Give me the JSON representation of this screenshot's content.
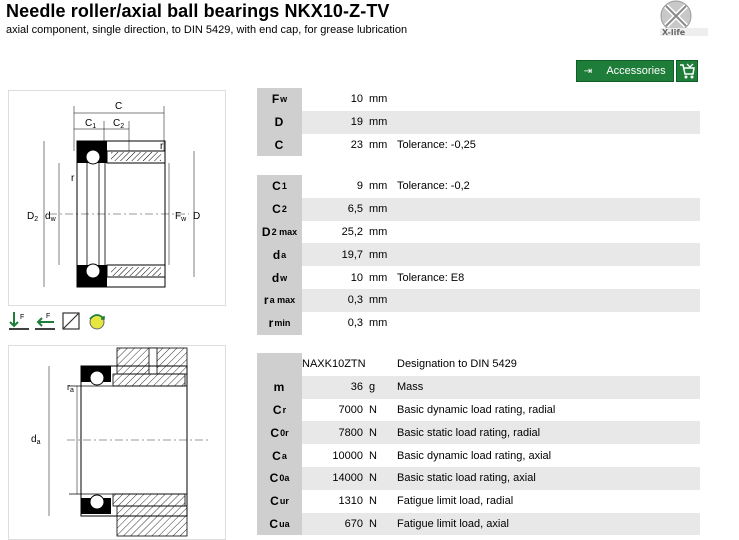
{
  "header": {
    "title": "Needle roller/axial ball bearings NKX10-Z-TV",
    "subtitle": "axial component, single direction, to DIN 5429, with end cap, for grease lubrication"
  },
  "toolbar": {
    "accessories_label": "Accessories"
  },
  "drawing1_labels": {
    "C": "C",
    "C1": "C",
    "C1s": "1",
    "C2": "C",
    "C2s": "2",
    "r": "r",
    "D2": "D",
    "D2s": "2",
    "dw": "d",
    "dws": "w",
    "Fw": "F",
    "Fws": "w",
    "D": "D"
  },
  "drawing2_labels": {
    "ra": "r",
    "ras": "a",
    "da": "d",
    "das": "a"
  },
  "table1": [
    {
      "sym": "F",
      "sub": "w",
      "value": "10",
      "unit": "mm",
      "desc": ""
    },
    {
      "sym": "D",
      "sub": "",
      "value": "19",
      "unit": "mm",
      "desc": ""
    },
    {
      "sym": "C",
      "sub": "",
      "value": "23",
      "unit": "mm",
      "desc": "Tolerance: -0,25"
    }
  ],
  "table2": [
    {
      "sym": "C",
      "sub": "1",
      "value": "9",
      "unit": "mm",
      "desc": "Tolerance: -0,2"
    },
    {
      "sym": "C",
      "sub": "2",
      "value": "6,5",
      "unit": "mm",
      "desc": ""
    },
    {
      "sym": "D",
      "sub": "2 max",
      "value": "25,2",
      "unit": "mm",
      "desc": ""
    },
    {
      "sym": "d",
      "sub": "a",
      "value": "19,7",
      "unit": "mm",
      "desc": ""
    },
    {
      "sym": "d",
      "sub": "w",
      "value": "10",
      "unit": "mm",
      "desc": "Tolerance: E8"
    },
    {
      "sym": "r",
      "sub": "a max",
      "value": "0,3",
      "unit": "mm",
      "desc": ""
    },
    {
      "sym": "r",
      "sub": "min",
      "value": "0,3",
      "unit": "mm",
      "desc": ""
    }
  ],
  "table3": [
    {
      "sym": "",
      "sub": "",
      "value": "NAXK10ZTN",
      "unit": "",
      "desc": "Designation to DIN 5429"
    },
    {
      "sym": "m",
      "sub": "",
      "value": "36",
      "unit": "g",
      "desc": "Mass"
    },
    {
      "sym": "C",
      "sub": "r",
      "value": "7000",
      "unit": "N",
      "desc": "Basic dynamic load rating, radial"
    },
    {
      "sym": "C",
      "sub": "0r",
      "value": "7800",
      "unit": "N",
      "desc": "Basic static load rating, radial"
    },
    {
      "sym": "C",
      "sub": "a",
      "value": "10000",
      "unit": "N",
      "desc": "Basic dynamic load rating, axial"
    },
    {
      "sym": "C",
      "sub": "0a",
      "value": "14000",
      "unit": "N",
      "desc": "Basic static load rating, axial"
    },
    {
      "sym": "C",
      "sub": "ur",
      "value": "1310",
      "unit": "N",
      "desc": "Fatigue limit load, radial"
    },
    {
      "sym": "C",
      "sub": "ua",
      "value": "670",
      "unit": "N",
      "desc": "Fatigue limit load, axial"
    }
  ],
  "colors": {
    "accent_green": "#1d7d39",
    "row_alt": "#e8e8e8",
    "symbol_cell": "#cfcfcf"
  },
  "icons": [
    "radial-load-icon",
    "axial-load-icon",
    "section-view-icon",
    "rotation-view-icon"
  ]
}
